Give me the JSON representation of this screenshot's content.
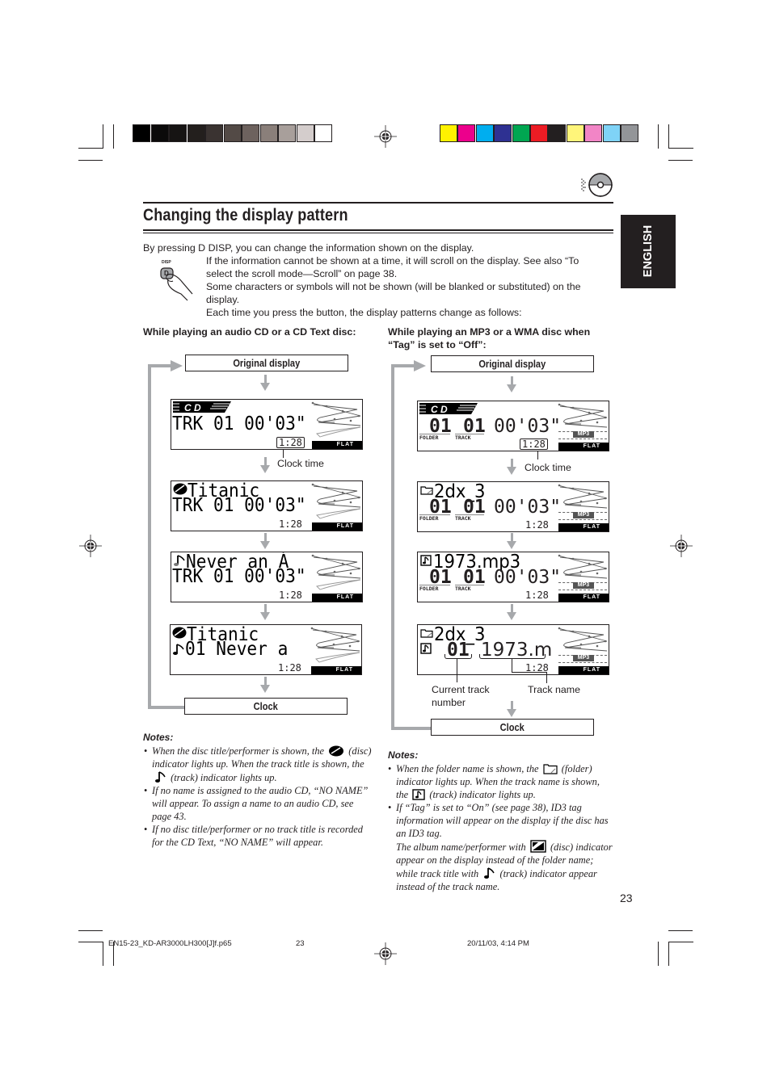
{
  "color_bar": {
    "grayscale": [
      "#000000",
      "#0b0a0a",
      "#161413",
      "#231f1d",
      "#3a3331",
      "#534a46",
      "#6d625e",
      "#8a7f7a",
      "#a89f9b",
      "#d4cdcc",
      "#ffffff"
    ],
    "colors": [
      "#fff200",
      "#ec008c",
      "#00aeef",
      "#2e3192",
      "#00a651",
      "#ed1c24",
      "#231f20",
      "#fff57a",
      "#f285c6",
      "#7fd3f7",
      "#939598"
    ]
  },
  "header": {
    "title": "Changing the display pattern",
    "language_tab": "ENGLISH",
    "cd_icon": "cd-disc-icon"
  },
  "intro": {
    "line1": "By pressing D DISP, you can change the information shown on the display.",
    "button_caption": "DISP",
    "button_letter": "D",
    "paragraphs": [
      "If the information cannot be shown at a time, it will scroll on the display. See also “To select the scroll mode—Scroll” on page 38.",
      "Some characters or symbols will not be shown (will be blanked or substituted) on the display.",
      "Each time you press the button, the display patterns change as follows:"
    ]
  },
  "left_column": {
    "heading": "While playing an audio CD or a CD Text disc:",
    "start_label": "Original display",
    "end_label": "Clock",
    "clock_time_label": "Clock time",
    "displays": [
      {
        "line1": "",
        "line2": "TRK 01 00'03\"",
        "clock": "1:28",
        "eq": "FLAT",
        "cd_logo": true
      },
      {
        "line1": "Titanic",
        "line2": "TRK 01 00'03\"",
        "clock": "1:28",
        "eq": "FLAT",
        "indicator1": "disc-icon"
      },
      {
        "line1": "Never an Á",
        "line2": "TRK 01 00'03\"",
        "clock": "1:28",
        "eq": "FLAT",
        "indicator1": "track-note-icon"
      },
      {
        "line1": "Titanic",
        "line2": "01 Never a",
        "clock": "1:28",
        "eq": "FLAT",
        "indicator1": "disc-icon",
        "indicator2": "track-note-icon"
      }
    ]
  },
  "right_column": {
    "heading_line1": "While playing an MP3 or a WMA disc when",
    "heading_line2": "“Tag” is set to “Off”:",
    "start_label": "Original display",
    "end_label": "Clock",
    "clock_time_label": "Clock time",
    "current_track_label_1": "Current track",
    "current_track_label_2": "number",
    "track_name_label": "Track name",
    "displays": [
      {
        "line1": "",
        "folder": "01",
        "track": "01",
        "time": "00'03\"",
        "folder_sub": "FOLDER",
        "track_sub": "TRACK",
        "format": "MP3",
        "clock": "1:28",
        "eq": "FLAT",
        "cd_logo": true
      },
      {
        "line1": "2dx_3",
        "folder": "01",
        "track": "01",
        "time": "00'03\"",
        "folder_sub": "FOLDER",
        "track_sub": "TRACK",
        "format": "MP3",
        "clock": "1:28",
        "eq": "FLAT",
        "indicator1": "folder-icon"
      },
      {
        "line1": "1973.mp3",
        "folder": "01",
        "track": "01",
        "time": "00'03\"",
        "folder_sub": "FOLDER",
        "track_sub": "TRACK",
        "format": "MP3",
        "clock": "1:28",
        "eq": "FLAT",
        "indicator1": "track-file-icon"
      },
      {
        "line1": "2dx_3",
        "line2_num": "01",
        "line2_name": "1973.m",
        "format": "MP3",
        "clock": "1:28",
        "eq": "FLAT",
        "indicator1": "folder-icon",
        "indicator2": "track-file-icon"
      }
    ]
  },
  "notes_left": {
    "heading": "Notes:",
    "n1_a": "When the disc title/performer is shown, the",
    "n1_b": "(disc) indicator lights up. When the track title is shown, the",
    "n1_c": "(track) indicator lights up.",
    "n2": "If no name is assigned to the audio CD, “NO NAME” will appear. To assign a name to an audio CD, see page 43.",
    "n3": "If no disc title/performer or no track title is recorded for the CD Text, “NO NAME” will appear."
  },
  "notes_right": {
    "heading": "Notes:",
    "n1_a": "When the folder name is shown, the",
    "n1_b": "(folder) indicator lights up. When the track name is shown, the",
    "n1_c": "(track) indicator lights up.",
    "n2": "If “Tag” is set to “On” (see page 38), ID3 tag information will appear on the display if the disc has an ID3 tag.",
    "n3_a": "The album name/performer with",
    "n3_b": "(disc) indicator appear on the display instead of the folder name; while track title with",
    "n3_c": "(track) indicator appear instead of the track name."
  },
  "page_number": "23",
  "footer": {
    "file": "EN15-23_KD-AR3000LH300[J]f.p65",
    "page": "23",
    "date": "20/11/03, 4:14 PM"
  }
}
